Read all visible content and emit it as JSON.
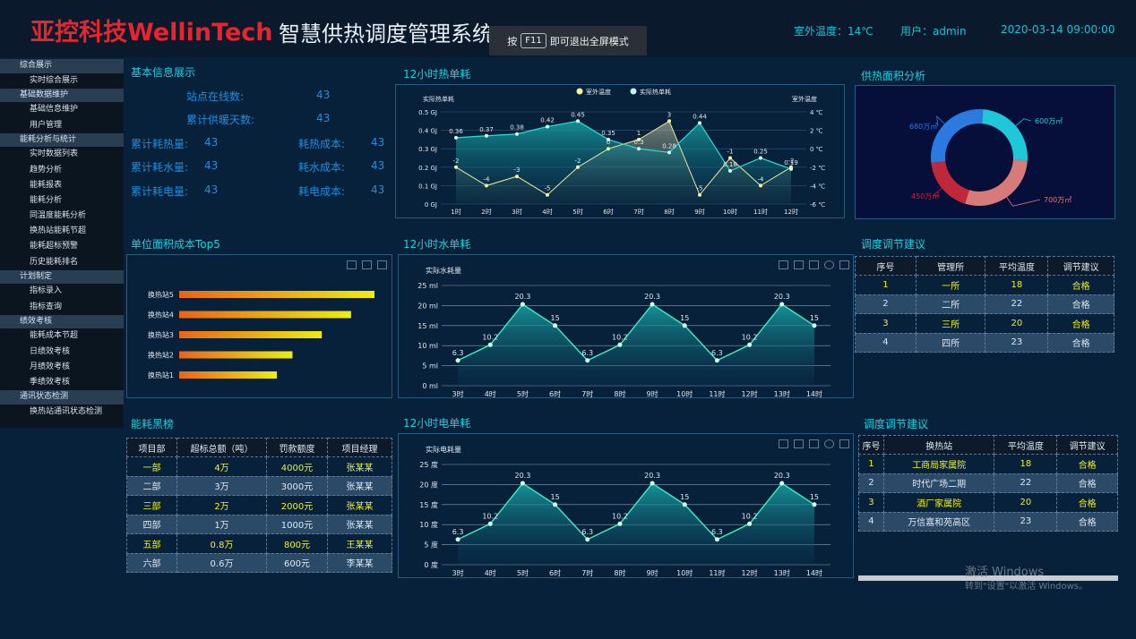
{
  "header": {
    "logo": "亚控科技WellinTech",
    "title": "智慧供热调度管理系统",
    "f11_pre": "按",
    "f11_key": "F11",
    "f11_post": "即可退出全屏模式",
    "outdoor_temp": "室外温度：14℃",
    "user": "用户：admin",
    "datetime": "2020-03-14 09:00:00"
  },
  "sidebar": [
    {
      "group": "综合展示",
      "items": [
        "实时综合展示"
      ]
    },
    {
      "group": "基础数据维护",
      "items": [
        "基础信息维护",
        "用户管理"
      ]
    },
    {
      "group": "能耗分析与统计",
      "items": [
        "实时数据列表",
        "趋势分析",
        "能耗报表",
        "能耗分析",
        "同温度能耗分析",
        "换热站能耗节超",
        "能耗超标预警",
        "历史能耗排名"
      ]
    },
    {
      "group": "计划制定",
      "items": [
        "指标录入",
        "指标查询"
      ]
    },
    {
      "group": "绩效考核",
      "items": [
        "能耗成本节超",
        "日绩效考核",
        "月绩效考核",
        "季绩效考核"
      ]
    },
    {
      "group": "通讯状态检测",
      "items": [
        "换热站通讯状态检测"
      ]
    }
  ],
  "basic_info": {
    "title": "基本信息展示",
    "online_label": "站点在线数:",
    "online_value": "43",
    "days_label": "累计供暖天数:",
    "days_value": "43",
    "heat_label": "累计耗热量:",
    "heat_value": "43",
    "heat_cost_label": "耗热成本:",
    "heat_cost_value": "43",
    "water_label": "累计耗水量:",
    "water_value": "43",
    "water_cost_label": "耗水成本:",
    "water_cost_value": "43",
    "elec_label": "累计耗电量:",
    "elec_value": "43",
    "elec_cost_label": "耗电成本:",
    "elec_cost_value": "43"
  },
  "top5": {
    "title": "单位面积成本Top5",
    "items": [
      {
        "label": "换热站5",
        "value": 100
      },
      {
        "label": "换热站4",
        "value": 88
      },
      {
        "label": "换热站3",
        "value": 73
      },
      {
        "label": "换热站2",
        "value": 58
      },
      {
        "label": "换热站1",
        "value": 50
      }
    ]
  },
  "blacklist": {
    "title": "能耗黑榜",
    "headers": [
      "项目部",
      "超标总额（吨）",
      "罚款额度",
      "项目经理"
    ],
    "rows": [
      [
        "一部",
        "4万",
        "4000元",
        "张某某"
      ],
      [
        "二部",
        "3万",
        "3000元",
        "张某某"
      ],
      [
        "三部",
        "2万",
        "2000元",
        "张某某"
      ],
      [
        "四部",
        "1万",
        "1000元",
        "张某某"
      ],
      [
        "五部",
        "0.8万",
        "800元",
        "王某某"
      ],
      [
        "六部",
        "0.6万",
        "600元",
        "李某某"
      ]
    ]
  },
  "heat_chart": {
    "title": "12小时热单耗",
    "legend": [
      "室外温度",
      "实际热单耗"
    ],
    "ylabel_left": "实际热单耗",
    "ylabel_right": "室外温度",
    "left_ticks": [
      "0.5 GJ",
      "0.4 GJ",
      "0.3 GJ",
      "0.2 GJ",
      "0.1 GJ",
      "0 GJ"
    ],
    "right_ticks": [
      "4 ℃",
      "2 ℃",
      "0 ℃",
      "-2 ℃",
      "-4 ℃",
      "-6 ℃"
    ],
    "chart_data": {
      "type": "line",
      "categories": [
        "1时",
        "2时",
        "3时",
        "4时",
        "5时",
        "6时",
        "7时",
        "8时",
        "9时",
        "10时",
        "11时",
        "12时"
      ],
      "series": [
        {
          "name": "实际热单耗",
          "values": [
            0.36,
            0.37,
            0.38,
            0.42,
            0.45,
            0.35,
            0.3,
            0.28,
            0.44,
            0.18,
            0.25,
            0.19
          ]
        },
        {
          "name": "室外温度",
          "values": [
            -2,
            -4,
            -3,
            -5,
            -2,
            0,
            1,
            3,
            -5,
            -1,
            -4,
            -2
          ]
        }
      ],
      "ylim_left": [
        0,
        0.5
      ],
      "ylim_right": [
        -6,
        4
      ]
    }
  },
  "water_chart": {
    "title": "12小时水单耗",
    "ylabel": "实际水耗量",
    "ticks": [
      "25 ml",
      "20 ml",
      "15 ml",
      "10 ml",
      "5 ml",
      "0 ml"
    ],
    "chart_data": {
      "type": "area",
      "categories": [
        "3时",
        "4时",
        "5时",
        "6时",
        "7时",
        "8时",
        "9时",
        "10时",
        "11时",
        "12时",
        "13时",
        "14时"
      ],
      "values": [
        6.3,
        10.2,
        20.3,
        15,
        6.3,
        10.2,
        20.3,
        15,
        6.3,
        10.2,
        20.3,
        15
      ],
      "ylim": [
        0,
        25
      ]
    }
  },
  "elec_chart": {
    "title": "12小时电单耗",
    "ylabel": "实际电耗量",
    "ticks": [
      "25 度",
      "20 度",
      "15 度",
      "10 度",
      "5 度",
      "0 度"
    ],
    "chart_data": {
      "type": "area",
      "categories": [
        "3时",
        "4时",
        "5时",
        "6时",
        "7时",
        "8时",
        "9时",
        "10时",
        "11时",
        "12时",
        "13时",
        "14时"
      ],
      "values": [
        6.3,
        10.2,
        20.3,
        15,
        6.3,
        10.2,
        20.3,
        15,
        6.3,
        10.2,
        20.3,
        15
      ],
      "ylim": [
        0,
        25
      ]
    }
  },
  "area_chart": {
    "title": "供热面积分析",
    "chart_data": {
      "type": "pie",
      "slices": [
        {
          "label": "600万㎡",
          "value": 600,
          "color": "#1ec8d8"
        },
        {
          "label": "700万㎡",
          "value": 700,
          "color": "#d77a7a"
        },
        {
          "label": "450万㎡",
          "value": 450,
          "color": "#c0283a"
        },
        {
          "label": "680万㎡",
          "value": 680,
          "color": "#2a7ae0"
        }
      ]
    }
  },
  "advice1": {
    "title": "调度调节建议",
    "headers": [
      "序号",
      "管理所",
      "平均温度",
      "调节建议"
    ],
    "rows": [
      [
        "1",
        "一所",
        "18",
        "合格"
      ],
      [
        "2",
        "二所",
        "22",
        "合格"
      ],
      [
        "3",
        "三所",
        "20",
        "合格"
      ],
      [
        "4",
        "四所",
        "23",
        "合格"
      ]
    ]
  },
  "advice2": {
    "title": "调度调节建议",
    "headers": [
      "序号",
      "换热站",
      "平均温度",
      "调节建议"
    ],
    "rows": [
      [
        "1",
        "工商局家属院",
        "18",
        "合格"
      ],
      [
        "2",
        "时代广场二期",
        "22",
        "合格"
      ],
      [
        "3",
        "酒厂家属院",
        "20",
        "合格"
      ],
      [
        "4",
        "万信嘉和苑高区",
        "23",
        "合格"
      ]
    ]
  },
  "watermark": {
    "line1": "激活 Windows",
    "line2": "转到\"设置\"以激活 Windows。"
  }
}
